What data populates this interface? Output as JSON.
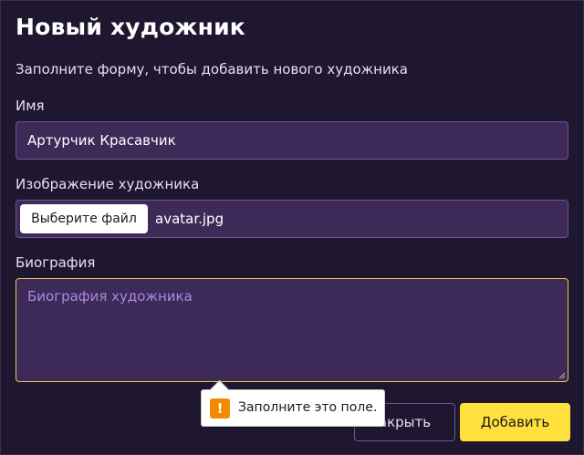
{
  "dialog": {
    "title": "Новый художник",
    "subtitle": "Заполните форму, чтобы добавить нового художника"
  },
  "form": {
    "name": {
      "label": "Имя",
      "value": "Артурчик Красавчик"
    },
    "image": {
      "label": "Изображение художника",
      "button_label": "Выберите файл",
      "file_name": "avatar.jpg"
    },
    "bio": {
      "label": "Биография",
      "placeholder": "Биография художника"
    }
  },
  "actions": {
    "close_label": "Закрыть",
    "close_visible_text": "акрыть",
    "add_label": "Добавить"
  },
  "validation": {
    "message": "Заполните это поле.",
    "icon": "warning-icon"
  },
  "colors": {
    "background": "#1f1730",
    "field": "#3d2a58",
    "accent": "#ffe03d",
    "focus_border": "#e8c94a",
    "placeholder": "#a98ad9",
    "warning": "#f08c00"
  }
}
